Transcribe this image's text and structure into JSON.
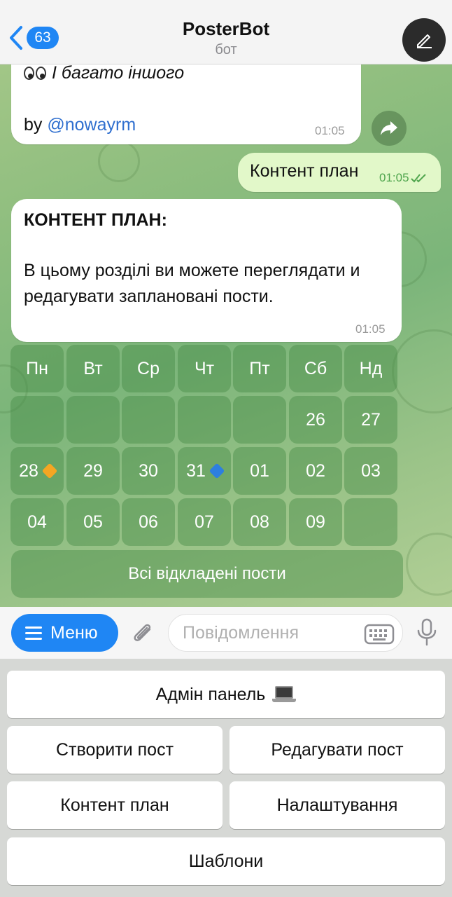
{
  "header": {
    "back_count": "63",
    "title": "PosterBot",
    "subtitle": "бот"
  },
  "messages": {
    "top": {
      "line1": "І багато іншого",
      "by_prefix": "by ",
      "by_link": "@nowayrm",
      "time": "01:05"
    },
    "outgoing": {
      "text": "Контент план",
      "time": "01:05"
    },
    "plan": {
      "title": "КОНТЕНТ ПЛАН:",
      "text": "В цьому розділі ви можете переглядати и редагувати заплановані пости.",
      "time": "01:05"
    }
  },
  "calendar": {
    "weekdays": [
      "Пн",
      "Вт",
      "Ср",
      "Чт",
      "Пт",
      "Сб",
      "Нд"
    ],
    "rows": [
      [
        "",
        "",
        "",
        "",
        "",
        "26",
        "27"
      ],
      [
        "28",
        "29",
        "30",
        "31",
        "01",
        "02",
        "03"
      ],
      [
        "04",
        "05",
        "06",
        "07",
        "08",
        "09",
        ""
      ]
    ],
    "marker_colors": {
      "orange": "#f5a623",
      "blue": "#2d7fe0"
    },
    "all_posts": "Всі відкладені пости"
  },
  "input_bar": {
    "menu_label": "Меню",
    "placeholder": "Повідомлення"
  },
  "reply_keyboard": {
    "admin_panel": "Адмін панель",
    "create_post": "Створити пост",
    "edit_post": "Редагувати пост",
    "content_plan": "Контент план",
    "settings": "Налаштування",
    "templates": "Шаблони"
  },
  "colors": {
    "accent": "#1f86f4",
    "outgoing_bubble": "#e2f8c9",
    "read_check": "#4fa54d"
  }
}
